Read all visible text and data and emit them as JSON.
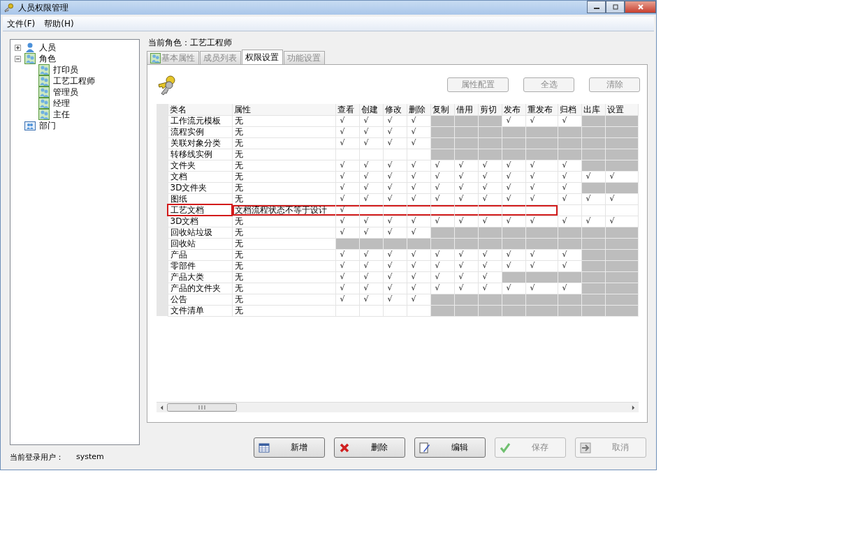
{
  "window": {
    "title": "人员权限管理"
  },
  "menu": [
    "文件(F)",
    "帮助(H)"
  ],
  "tree": [
    {
      "label": "人员",
      "kind": "person",
      "expanded": false
    },
    {
      "label": "角色",
      "kind": "group",
      "expanded": true,
      "children": [
        {
          "label": "打印员",
          "kind": "group"
        },
        {
          "label": "工艺工程师",
          "kind": "group"
        },
        {
          "label": "管理员",
          "kind": "group"
        },
        {
          "label": "经理",
          "kind": "group"
        },
        {
          "label": "主任",
          "kind": "group"
        }
      ]
    },
    {
      "label": "部门",
      "kind": "department"
    }
  ],
  "login": {
    "label": "当前登录用户：",
    "user": "system"
  },
  "current_role": "当前角色：工艺工程师",
  "tabs": [
    {
      "label": "基本属性",
      "selected": false,
      "disabled": true,
      "icon": true
    },
    {
      "label": "成员列表",
      "selected": false,
      "disabled": true
    },
    {
      "label": "权限设置",
      "selected": true,
      "disabled": false
    },
    {
      "label": "功能设置",
      "selected": false,
      "disabled": true
    }
  ],
  "tool_buttons": [
    {
      "label": "属性配置",
      "disabled": true
    },
    {
      "label": "全选",
      "disabled": true
    },
    {
      "label": "清除",
      "disabled": true
    }
  ],
  "table": {
    "columns": [
      "类名",
      "属性",
      "查看",
      "创建",
      "修改",
      "删除",
      "复制",
      "借用",
      "剪切",
      "发布",
      "重发布",
      "归档",
      "出库",
      "设置"
    ],
    "check": "√",
    "rows": [
      {
        "name": "工作流元模板",
        "attr": "无",
        "highlighted": false,
        "cells": [
          {
            "checked": true,
            "disabled": false
          },
          {
            "checked": true,
            "disabled": false
          },
          {
            "checked": true,
            "disabled": false
          },
          {
            "checked": true,
            "disabled": false
          },
          {
            "checked": false,
            "disabled": true
          },
          {
            "checked": false,
            "disabled": true
          },
          {
            "checked": false,
            "disabled": true
          },
          {
            "checked": true,
            "disabled": false
          },
          {
            "checked": true,
            "disabled": false
          },
          {
            "checked": true,
            "disabled": false
          },
          {
            "checked": false,
            "disabled": true
          },
          {
            "checked": false,
            "disabled": true
          }
        ]
      },
      {
        "name": "流程实例",
        "attr": "无",
        "highlighted": false,
        "cells": [
          {
            "checked": true,
            "disabled": false
          },
          {
            "checked": true,
            "disabled": false
          },
          {
            "checked": true,
            "disabled": false
          },
          {
            "checked": true,
            "disabled": false
          },
          {
            "checked": false,
            "disabled": true
          },
          {
            "checked": false,
            "disabled": true
          },
          {
            "checked": false,
            "disabled": true
          },
          {
            "checked": false,
            "disabled": true
          },
          {
            "checked": false,
            "disabled": true
          },
          {
            "checked": false,
            "disabled": true
          },
          {
            "checked": false,
            "disabled": true
          },
          {
            "checked": false,
            "disabled": true
          }
        ]
      },
      {
        "name": "关联对象分类",
        "attr": "无",
        "highlighted": false,
        "cells": [
          {
            "checked": true,
            "disabled": false
          },
          {
            "checked": true,
            "disabled": false
          },
          {
            "checked": true,
            "disabled": false
          },
          {
            "checked": true,
            "disabled": false
          },
          {
            "checked": false,
            "disabled": true
          },
          {
            "checked": false,
            "disabled": true
          },
          {
            "checked": false,
            "disabled": true
          },
          {
            "checked": false,
            "disabled": true
          },
          {
            "checked": false,
            "disabled": true
          },
          {
            "checked": false,
            "disabled": true
          },
          {
            "checked": false,
            "disabled": true
          },
          {
            "checked": false,
            "disabled": true
          }
        ]
      },
      {
        "name": "转移线实例",
        "attr": "无",
        "highlighted": false,
        "cells": [
          {
            "checked": false,
            "disabled": false
          },
          {
            "checked": false,
            "disabled": false
          },
          {
            "checked": false,
            "disabled": false
          },
          {
            "checked": false,
            "disabled": false
          },
          {
            "checked": false,
            "disabled": true
          },
          {
            "checked": false,
            "disabled": true
          },
          {
            "checked": false,
            "disabled": true
          },
          {
            "checked": false,
            "disabled": true
          },
          {
            "checked": false,
            "disabled": true
          },
          {
            "checked": false,
            "disabled": true
          },
          {
            "checked": false,
            "disabled": true
          },
          {
            "checked": false,
            "disabled": true
          }
        ]
      },
      {
        "name": "文件夹",
        "attr": "无",
        "highlighted": false,
        "cells": [
          {
            "checked": true,
            "disabled": false
          },
          {
            "checked": true,
            "disabled": false
          },
          {
            "checked": true,
            "disabled": false
          },
          {
            "checked": true,
            "disabled": false
          },
          {
            "checked": true,
            "disabled": false
          },
          {
            "checked": true,
            "disabled": false
          },
          {
            "checked": true,
            "disabled": false
          },
          {
            "checked": true,
            "disabled": false
          },
          {
            "checked": true,
            "disabled": false
          },
          {
            "checked": true,
            "disabled": false
          },
          {
            "checked": false,
            "disabled": true
          },
          {
            "checked": false,
            "disabled": true
          }
        ]
      },
      {
        "name": "文档",
        "attr": "无",
        "highlighted": false,
        "cells": [
          {
            "checked": true,
            "disabled": false
          },
          {
            "checked": true,
            "disabled": false
          },
          {
            "checked": true,
            "disabled": false
          },
          {
            "checked": true,
            "disabled": false
          },
          {
            "checked": true,
            "disabled": false
          },
          {
            "checked": true,
            "disabled": false
          },
          {
            "checked": true,
            "disabled": false
          },
          {
            "checked": true,
            "disabled": false
          },
          {
            "checked": true,
            "disabled": false
          },
          {
            "checked": true,
            "disabled": false
          },
          {
            "checked": true,
            "disabled": false
          },
          {
            "checked": true,
            "disabled": false
          }
        ]
      },
      {
        "name": "3D文件夹",
        "attr": "无",
        "highlighted": false,
        "cells": [
          {
            "checked": true,
            "disabled": false
          },
          {
            "checked": true,
            "disabled": false
          },
          {
            "checked": true,
            "disabled": false
          },
          {
            "checked": true,
            "disabled": false
          },
          {
            "checked": true,
            "disabled": false
          },
          {
            "checked": true,
            "disabled": false
          },
          {
            "checked": true,
            "disabled": false
          },
          {
            "checked": true,
            "disabled": false
          },
          {
            "checked": true,
            "disabled": false
          },
          {
            "checked": true,
            "disabled": false
          },
          {
            "checked": false,
            "disabled": true
          },
          {
            "checked": false,
            "disabled": true
          }
        ]
      },
      {
        "name": "图纸",
        "attr": "无",
        "highlighted": false,
        "cells": [
          {
            "checked": true,
            "disabled": false
          },
          {
            "checked": true,
            "disabled": false
          },
          {
            "checked": true,
            "disabled": false
          },
          {
            "checked": true,
            "disabled": false
          },
          {
            "checked": true,
            "disabled": false
          },
          {
            "checked": true,
            "disabled": false
          },
          {
            "checked": true,
            "disabled": false
          },
          {
            "checked": true,
            "disabled": false
          },
          {
            "checked": true,
            "disabled": false
          },
          {
            "checked": true,
            "disabled": false
          },
          {
            "checked": true,
            "disabled": false
          },
          {
            "checked": true,
            "disabled": false
          }
        ]
      },
      {
        "name": "工艺文档",
        "attr": "文档流程状态不等于设计",
        "highlighted": true,
        "cells": [
          {
            "checked": true,
            "disabled": false
          },
          {
            "checked": false,
            "disabled": false
          },
          {
            "checked": false,
            "disabled": false
          },
          {
            "checked": false,
            "disabled": false
          },
          {
            "checked": false,
            "disabled": false
          },
          {
            "checked": false,
            "disabled": false
          },
          {
            "checked": false,
            "disabled": false
          },
          {
            "checked": false,
            "disabled": false
          },
          {
            "checked": false,
            "disabled": false
          },
          {
            "checked": false,
            "disabled": false
          },
          {
            "checked": false,
            "disabled": false
          },
          {
            "checked": false,
            "disabled": false
          }
        ]
      },
      {
        "name": "3D文档",
        "attr": "无",
        "highlighted": false,
        "cells": [
          {
            "checked": true,
            "disabled": false
          },
          {
            "checked": true,
            "disabled": false
          },
          {
            "checked": true,
            "disabled": false
          },
          {
            "checked": true,
            "disabled": false
          },
          {
            "checked": true,
            "disabled": false
          },
          {
            "checked": true,
            "disabled": false
          },
          {
            "checked": true,
            "disabled": false
          },
          {
            "checked": true,
            "disabled": false
          },
          {
            "checked": true,
            "disabled": false
          },
          {
            "checked": true,
            "disabled": false
          },
          {
            "checked": true,
            "disabled": false
          },
          {
            "checked": true,
            "disabled": false
          }
        ]
      },
      {
        "name": "回收站垃圾",
        "attr": "无",
        "highlighted": false,
        "cells": [
          {
            "checked": true,
            "disabled": false
          },
          {
            "checked": true,
            "disabled": false
          },
          {
            "checked": true,
            "disabled": false
          },
          {
            "checked": true,
            "disabled": false
          },
          {
            "checked": false,
            "disabled": true
          },
          {
            "checked": false,
            "disabled": true
          },
          {
            "checked": false,
            "disabled": true
          },
          {
            "checked": false,
            "disabled": true
          },
          {
            "checked": false,
            "disabled": true
          },
          {
            "checked": false,
            "disabled": true
          },
          {
            "checked": false,
            "disabled": true
          },
          {
            "checked": false,
            "disabled": true
          }
        ]
      },
      {
        "name": "回收站",
        "attr": "无",
        "highlighted": false,
        "cells": [
          {
            "checked": false,
            "disabled": true
          },
          {
            "checked": false,
            "disabled": true
          },
          {
            "checked": false,
            "disabled": true
          },
          {
            "checked": false,
            "disabled": true
          },
          {
            "checked": false,
            "disabled": true
          },
          {
            "checked": false,
            "disabled": true
          },
          {
            "checked": false,
            "disabled": true
          },
          {
            "checked": false,
            "disabled": true
          },
          {
            "checked": false,
            "disabled": true
          },
          {
            "checked": false,
            "disabled": true
          },
          {
            "checked": false,
            "disabled": true
          },
          {
            "checked": false,
            "disabled": true
          }
        ]
      },
      {
        "name": "产品",
        "attr": "无",
        "highlighted": false,
        "cells": [
          {
            "checked": true,
            "disabled": false
          },
          {
            "checked": true,
            "disabled": false
          },
          {
            "checked": true,
            "disabled": false
          },
          {
            "checked": true,
            "disabled": false
          },
          {
            "checked": true,
            "disabled": false
          },
          {
            "checked": true,
            "disabled": false
          },
          {
            "checked": true,
            "disabled": false
          },
          {
            "checked": true,
            "disabled": false
          },
          {
            "checked": true,
            "disabled": false
          },
          {
            "checked": true,
            "disabled": false
          },
          {
            "checked": false,
            "disabled": true
          },
          {
            "checked": false,
            "disabled": true
          }
        ]
      },
      {
        "name": "零部件",
        "attr": "无",
        "highlighted": false,
        "cells": [
          {
            "checked": true,
            "disabled": false
          },
          {
            "checked": true,
            "disabled": false
          },
          {
            "checked": true,
            "disabled": false
          },
          {
            "checked": true,
            "disabled": false
          },
          {
            "checked": true,
            "disabled": false
          },
          {
            "checked": true,
            "disabled": false
          },
          {
            "checked": true,
            "disabled": false
          },
          {
            "checked": true,
            "disabled": false
          },
          {
            "checked": true,
            "disabled": false
          },
          {
            "checked": true,
            "disabled": false
          },
          {
            "checked": false,
            "disabled": true
          },
          {
            "checked": false,
            "disabled": true
          }
        ]
      },
      {
        "name": "产品大类",
        "attr": "无",
        "highlighted": false,
        "cells": [
          {
            "checked": true,
            "disabled": false
          },
          {
            "checked": true,
            "disabled": false
          },
          {
            "checked": true,
            "disabled": false
          },
          {
            "checked": true,
            "disabled": false
          },
          {
            "checked": true,
            "disabled": false
          },
          {
            "checked": true,
            "disabled": false
          },
          {
            "checked": true,
            "disabled": false
          },
          {
            "checked": false,
            "disabled": true
          },
          {
            "checked": false,
            "disabled": true
          },
          {
            "checked": false,
            "disabled": true
          },
          {
            "checked": false,
            "disabled": true
          },
          {
            "checked": false,
            "disabled": true
          }
        ]
      },
      {
        "name": "产品的文件夹",
        "attr": "无",
        "highlighted": false,
        "cells": [
          {
            "checked": true,
            "disabled": false
          },
          {
            "checked": true,
            "disabled": false
          },
          {
            "checked": true,
            "disabled": false
          },
          {
            "checked": true,
            "disabled": false
          },
          {
            "checked": true,
            "disabled": false
          },
          {
            "checked": true,
            "disabled": false
          },
          {
            "checked": true,
            "disabled": false
          },
          {
            "checked": true,
            "disabled": false
          },
          {
            "checked": true,
            "disabled": false
          },
          {
            "checked": true,
            "disabled": false
          },
          {
            "checked": false,
            "disabled": true
          },
          {
            "checked": false,
            "disabled": true
          }
        ]
      },
      {
        "name": "公告",
        "attr": "无",
        "highlighted": false,
        "cells": [
          {
            "checked": true,
            "disabled": false
          },
          {
            "checked": true,
            "disabled": false
          },
          {
            "checked": true,
            "disabled": false
          },
          {
            "checked": true,
            "disabled": false
          },
          {
            "checked": false,
            "disabled": true
          },
          {
            "checked": false,
            "disabled": true
          },
          {
            "checked": false,
            "disabled": true
          },
          {
            "checked": false,
            "disabled": true
          },
          {
            "checked": false,
            "disabled": true
          },
          {
            "checked": false,
            "disabled": true
          },
          {
            "checked": false,
            "disabled": true
          },
          {
            "checked": false,
            "disabled": true
          }
        ]
      },
      {
        "name": "文件清单",
        "attr": "无",
        "highlighted": false,
        "cells": [
          {
            "checked": false,
            "disabled": false
          },
          {
            "checked": false,
            "disabled": false
          },
          {
            "checked": false,
            "disabled": false
          },
          {
            "checked": false,
            "disabled": false
          },
          {
            "checked": false,
            "disabled": true
          },
          {
            "checked": false,
            "disabled": true
          },
          {
            "checked": false,
            "disabled": true
          },
          {
            "checked": false,
            "disabled": true
          },
          {
            "checked": false,
            "disabled": true
          },
          {
            "checked": false,
            "disabled": true
          },
          {
            "checked": false,
            "disabled": true
          },
          {
            "checked": false,
            "disabled": true
          }
        ]
      }
    ]
  },
  "buttons": [
    {
      "label": "新增",
      "kind": "add",
      "disabled": false
    },
    {
      "label": "删除",
      "kind": "delete",
      "disabled": false
    },
    {
      "label": "编辑",
      "kind": "edit",
      "disabled": false
    },
    {
      "label": "保存",
      "kind": "save",
      "disabled": true
    },
    {
      "label": "取消",
      "kind": "cancel",
      "disabled": true
    }
  ]
}
